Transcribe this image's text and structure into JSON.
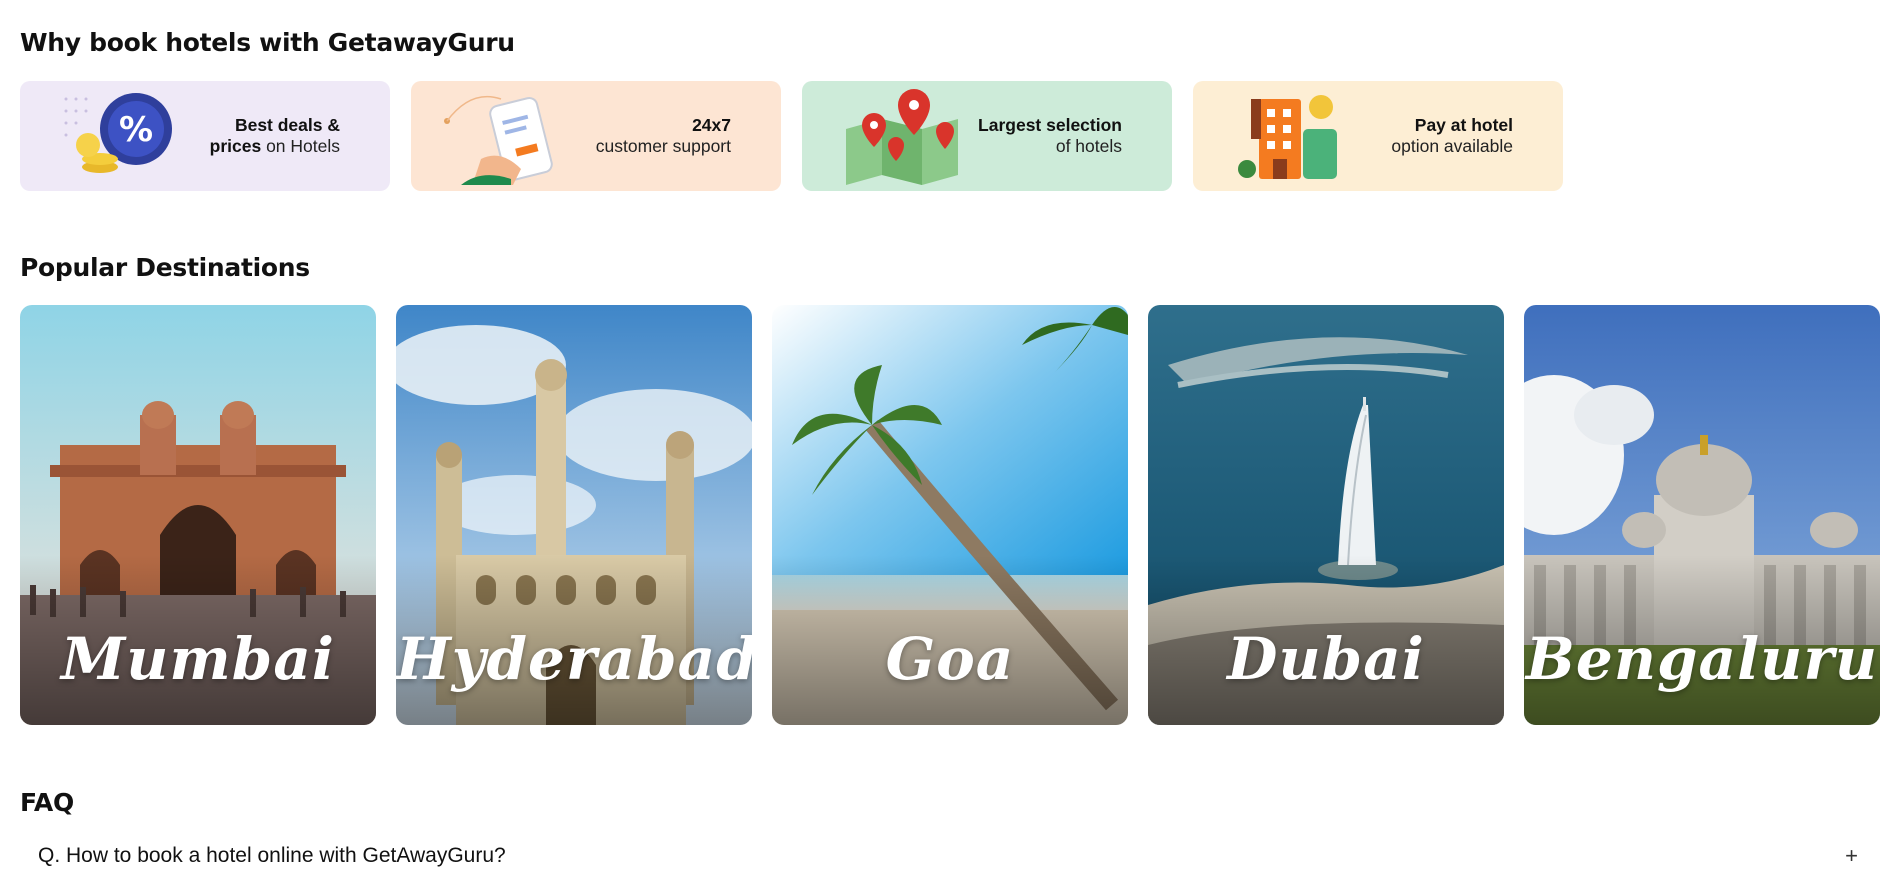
{
  "why": {
    "title": "Why book hotels with GetawayGuru",
    "features": [
      {
        "bold": "Best deals &",
        "bold2": "prices",
        "rest": " on Hotels",
        "bg": "#efe9f7"
      },
      {
        "bold": "24x7",
        "line2": "customer support",
        "bg": "#fde5d3"
      },
      {
        "bold": "Largest selection",
        "line2": "of hotels",
        "bg": "#cdebd9"
      },
      {
        "bold": "Pay at hotel",
        "line2": "option available",
        "bg": "#fdeed4"
      }
    ]
  },
  "popular": {
    "title": "Popular Destinations",
    "destinations": [
      {
        "name": "Mumbai"
      },
      {
        "name": "Hyderabad"
      },
      {
        "name": "Goa"
      },
      {
        "name": "Dubai"
      },
      {
        "name": "Bengaluru"
      }
    ]
  },
  "faq": {
    "title": "FAQ",
    "items": [
      {
        "question": "Q. How to book a hotel online with GetAwayGuru?",
        "toggle": "+"
      }
    ]
  }
}
